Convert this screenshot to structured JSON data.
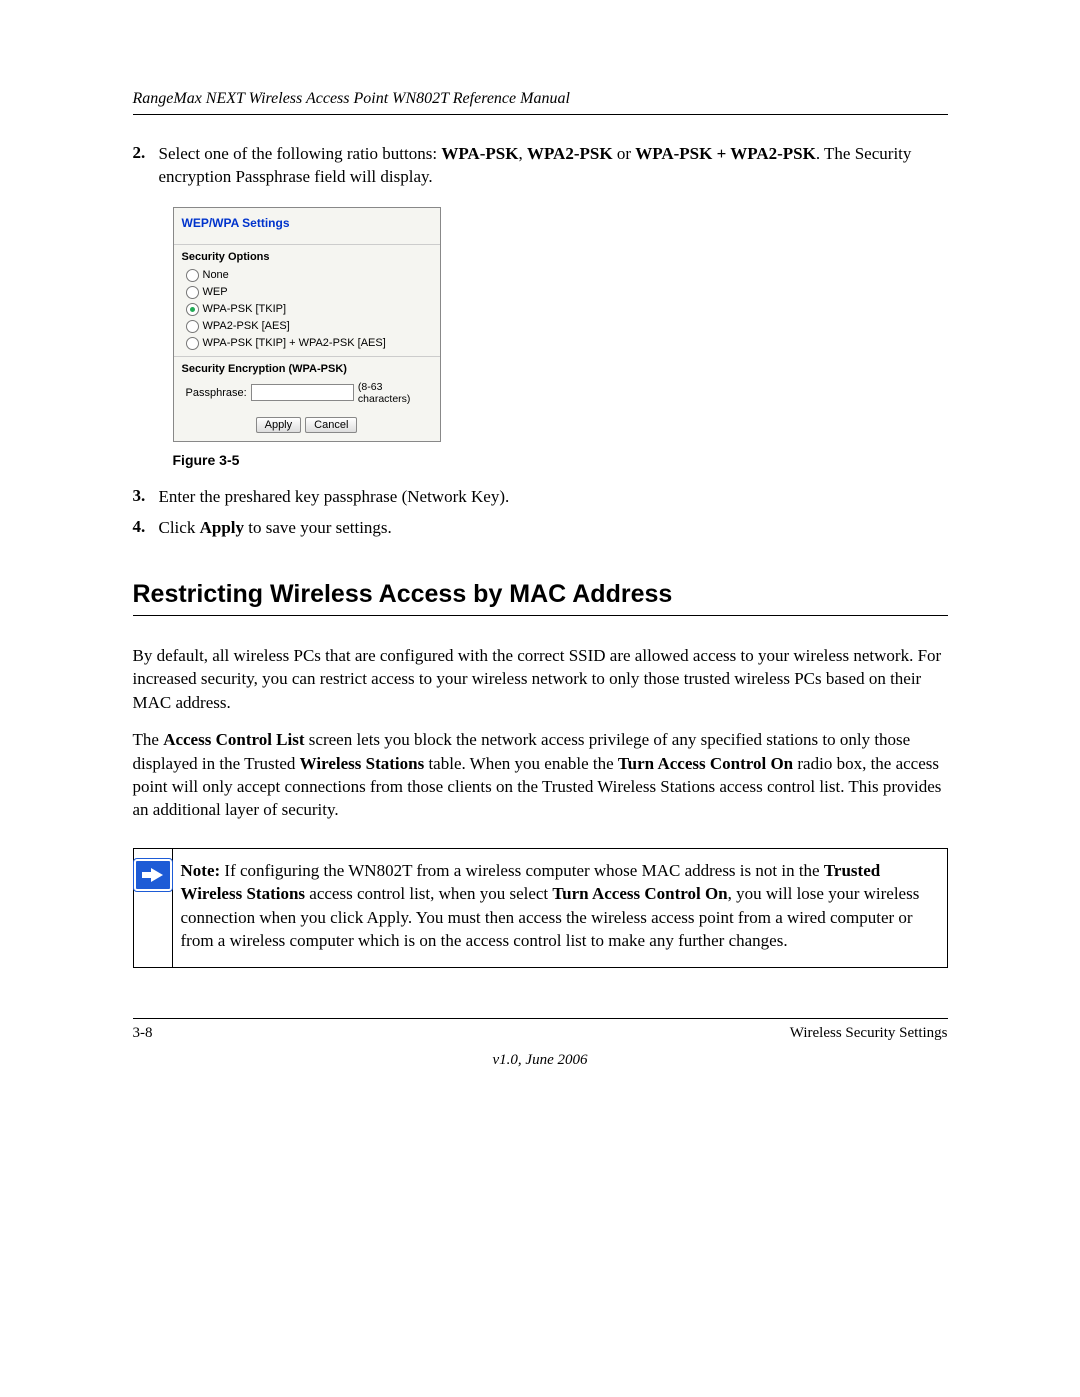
{
  "running_head": "RangeMax NEXT Wireless Access Point WN802T Reference Manual",
  "steps": [
    {
      "num": "2.",
      "prefix": "Select one of the following ratio buttons: ",
      "bold1": "WPA-PSK",
      "sep1": ", ",
      "bold2": "WPA2-PSK",
      "sep2": " or ",
      "bold3": "WPA-PSK + WPA2-PSK",
      "suffix": ". The Security encryption Passphrase field will display."
    },
    {
      "num": "3.",
      "text": "Enter the preshared key passphrase (Network Key)."
    },
    {
      "num": "4.",
      "prefix": "Click ",
      "bold1": "Apply",
      "suffix": " to save your settings."
    }
  ],
  "screenshot": {
    "title": "WEP/WPA Settings",
    "sec_options_head": "Security Options",
    "options": [
      {
        "label": "None",
        "selected": false
      },
      {
        "label": "WEP",
        "selected": false
      },
      {
        "label": "WPA-PSK [TKIP]",
        "selected": true
      },
      {
        "label": "WPA2-PSK [AES]",
        "selected": false
      },
      {
        "label": "WPA-PSK [TKIP] + WPA2-PSK [AES]",
        "selected": false
      }
    ],
    "enc_head": "Security Encryption (WPA-PSK)",
    "pass_label": "Passphrase:",
    "pass_hint": "(8-63 characters)",
    "apply": "Apply",
    "cancel": "Cancel"
  },
  "figure_caption": "Figure 3-5",
  "h2": "Restricting Wireless Access by MAC Address",
  "para1": "By default, all wireless PCs that are configured with the correct SSID are allowed access to your wireless network. For increased security, you can restrict access to your wireless network to only those trusted wireless PCs based on their MAC address.",
  "para2": {
    "t1": "The ",
    "b1": "Access Control List",
    "t2": " screen lets you block the network access privilege of any specified stations to only those displayed in the Trusted ",
    "b2": "Wireless Stations",
    "t3": " table. When you enable the ",
    "b3": "Turn Access Control On",
    "t4": " radio box, the access point will only accept connections from those clients on the Trusted Wireless Stations access control list. This provides an additional layer of security."
  },
  "note": {
    "lead": "Note:",
    "t1": " If configuring the WN802T from a wireless computer whose MAC address is not in the ",
    "b1": "Trusted Wireless Stations",
    "t2": " access control list, when you select ",
    "b2": "Turn Access Control On",
    "t3": ", you will lose your wireless connection when you click Apply. You must then access the wireless access point from a wired computer or from a wireless computer which is on the access control list to make any further changes."
  },
  "footer": {
    "left": "3-8",
    "right": "Wireless Security Settings",
    "version": "v1.0, June 2006"
  }
}
